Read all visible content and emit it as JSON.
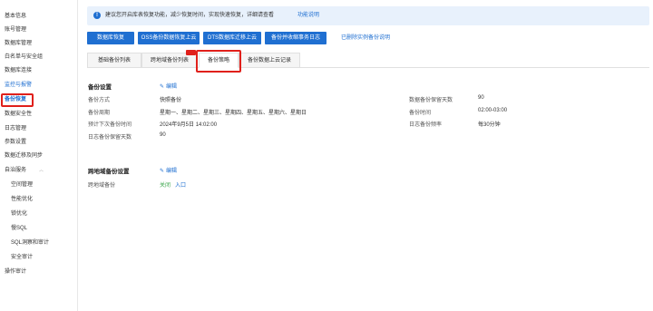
{
  "sidebar": {
    "items": [
      {
        "label": "基本信息"
      },
      {
        "label": "账号管理"
      },
      {
        "label": "数据库管理"
      },
      {
        "label": "白名单与安全组"
      },
      {
        "label": "数据库连接"
      },
      {
        "label": "监控与报警"
      },
      {
        "label": "备份恢复"
      },
      {
        "label": "数据安全性"
      },
      {
        "label": "日志管理"
      },
      {
        "label": "参数设置"
      },
      {
        "label": "数据迁移及同步"
      },
      {
        "label": "自治服务"
      },
      {
        "label": "空间管理"
      },
      {
        "label": "性能优化"
      },
      {
        "label": "锁优化"
      },
      {
        "label": "慢SQL"
      },
      {
        "label": "SQL洞察和审计"
      },
      {
        "label": "安全审计"
      },
      {
        "label": "操作审计"
      }
    ]
  },
  "banner": {
    "icon": "info-icon",
    "text": "建议您开启库表恢复功能，减少恢复时间，实现快速恢复，详细请查看",
    "link": "功能说明"
  },
  "toolbar": {
    "buttons": [
      "数据库恢复",
      "OSS备份数据恢复上云",
      "DTS数据库迁移上云",
      "备份并收缩事务日志"
    ],
    "link": "已删除实例备份说明"
  },
  "tabs": [
    "基础备份列表",
    "跨地域备份列表",
    "备份策略",
    "备份数据上云记录"
  ],
  "backup_settings": {
    "title": "备份设置",
    "edit": "编辑",
    "left": [
      {
        "label": "备份方式",
        "value": "快照备份"
      },
      {
        "label": "备份周期",
        "value": "星期一、星期二、星期三、星期四、星期五、星期六、星期日"
      },
      {
        "label": "预计下次备份时间",
        "value": "2024年9月5日 14:02:00"
      },
      {
        "label": "日志备份保留天数",
        "value": "90"
      }
    ],
    "right": [
      {
        "label": "数据备份保留天数",
        "value": "90"
      },
      {
        "label": "备份时间",
        "value": "02:00-03:00"
      },
      {
        "label": "日志备份频率",
        "value": "每30分钟"
      }
    ]
  },
  "cross_region": {
    "title": "跨地域备份设置",
    "edit": "编辑",
    "label": "跨地域备份",
    "status": "关闭",
    "entry": "入口"
  }
}
